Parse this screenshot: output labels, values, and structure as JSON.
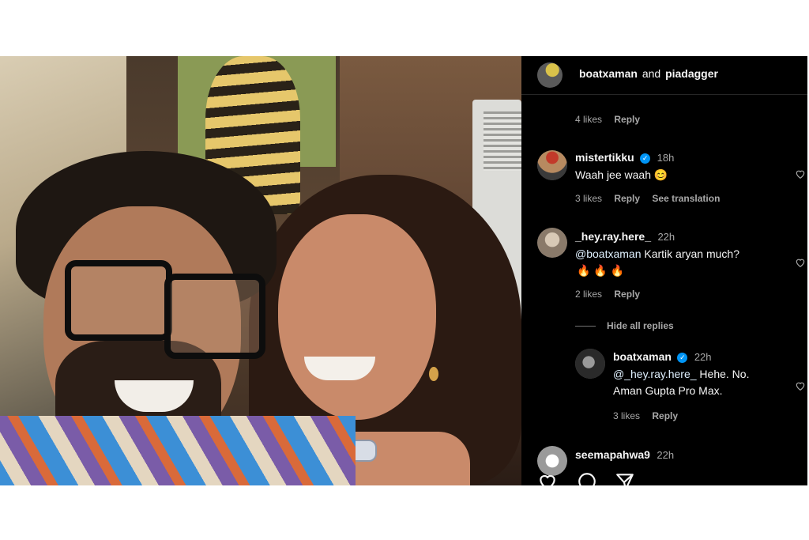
{
  "post": {
    "header": {
      "title": "boatxaman",
      "title_connector": "and",
      "title_coauthor": "piadagger"
    },
    "top_meta": {
      "likes": "4 likes",
      "reply": "Reply"
    },
    "comments": [
      {
        "username": "mistertikku",
        "verified": true,
        "time": "18h",
        "text": "Waah jee waah 😊",
        "likes": "3 likes",
        "reply": "Reply",
        "translate": "See translation"
      },
      {
        "username": "_hey.ray.here_",
        "verified": false,
        "time": "22h",
        "mention": "@boatxaman",
        "text": "Kartik aryan much?",
        "emoji_line": "🔥 🔥 🔥",
        "likes": "2 likes",
        "reply": "Reply",
        "hide_replies": "Hide all replies",
        "replies": [
          {
            "username": "boatxaman",
            "verified": true,
            "time": "22h",
            "mention": "@_hey.ray.here_",
            "text": "Hehe. No.",
            "text2": "Aman Gupta Pro Max.",
            "likes": "3 likes",
            "reply": "Reply"
          }
        ]
      },
      {
        "username": "seemapahwa9",
        "time": "22h"
      }
    ],
    "icons": {
      "like": "heart-icon",
      "comment": "comment-icon",
      "share": "send-icon"
    },
    "colors": {
      "background": "#000000",
      "text": "#f5f5f5",
      "muted": "#a8a8a8",
      "verified": "#0095f6"
    }
  }
}
